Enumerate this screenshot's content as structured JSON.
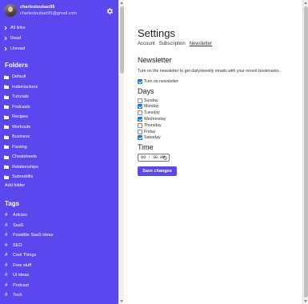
{
  "user": {
    "name": "charlesloubao95",
    "email": "charlesloubao95@gmail.com"
  },
  "nav": [
    {
      "label": "All links"
    },
    {
      "label": "Read"
    },
    {
      "label": "Unread"
    }
  ],
  "folders": {
    "title": "Folders",
    "items": [
      "Default",
      "IndieHackers",
      "Tutorials",
      "Podcasts",
      "Recipes",
      "Workouts",
      "Business",
      "Parsing",
      "Cheatsheets",
      "Relationships",
      "Subreddits"
    ],
    "add_label": "Add folder"
  },
  "tags": {
    "title": "Tags",
    "items": [
      "Articles",
      "SaaS",
      "Possible SaaS ideas",
      "SEO",
      "Cool Things",
      "Free stuff",
      "UI ideas",
      "Podcast",
      "Tech"
    ]
  },
  "settings": {
    "title": "Settings",
    "tabs": [
      {
        "label": "Account",
        "active": false
      },
      {
        "label": "Subscription",
        "active": false
      },
      {
        "label": "Newsletter",
        "active": true
      }
    ],
    "section_heading": "Newsletter",
    "description": "Turn on the newsletter to get daily/weekly emails with your recent bookmarks.",
    "toggle": {
      "label": "Turn on newsletter",
      "checked": true
    },
    "days_heading": "Days",
    "days": [
      {
        "label": "Sunday",
        "checked": false
      },
      {
        "label": "Monday",
        "checked": true
      },
      {
        "label": "Tuesday",
        "checked": false
      },
      {
        "label": "Wednesday",
        "checked": true
      },
      {
        "label": "Thursday",
        "checked": false
      },
      {
        "label": "Friday",
        "checked": false
      },
      {
        "label": "Saturday",
        "checked": true
      }
    ],
    "time_heading": "Time",
    "time": {
      "hour": "09",
      "minute": "30",
      "ampm": "AM"
    },
    "save_label": "Save changes"
  },
  "colors": {
    "accent": "#5a47ee",
    "checkbox": "#1a73e8"
  },
  "icons": {
    "gear": "gear-icon",
    "chevron": "chevron-right-icon",
    "folder": "folder-icon",
    "tag": "hash-icon",
    "clock": "clock-icon"
  }
}
